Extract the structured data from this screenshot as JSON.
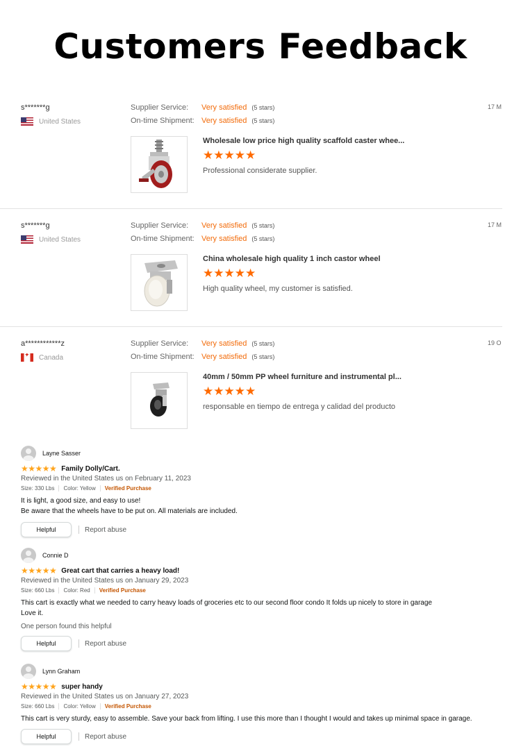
{
  "page": {
    "title": "Customers Feedback"
  },
  "supplier_reviews": [
    {
      "reviewer": "s*******g",
      "country": "United States",
      "flag_icon": "us-flag-icon",
      "date": "17 M",
      "service_label": "Supplier Service:",
      "service_value": "Very satisfied",
      "service_stars": "(5 stars)",
      "shipment_label": "On-time Shipment:",
      "shipment_value": "Very satisfied",
      "shipment_stars": "(5 stars)",
      "product_title": "Wholesale low price high quality scaffold caster whee...",
      "rating": "★★★★★",
      "comment": "Professional considerate supplier."
    },
    {
      "reviewer": "s*******g",
      "country": "United States",
      "flag_icon": "us-flag-icon",
      "date": "17 M",
      "service_label": "Supplier Service:",
      "service_value": "Very satisfied",
      "service_stars": "(5 stars)",
      "shipment_label": "On-time Shipment:",
      "shipment_value": "Very satisfied",
      "shipment_stars": "(5 stars)",
      "product_title": "China wholesale high quality 1 inch castor wheel",
      "rating": "★★★★★",
      "comment": "High quality wheel, my customer is satisfied."
    },
    {
      "reviewer": "a************z",
      "country": "Canada",
      "flag_icon": "canada-flag-icon",
      "date": "19 O",
      "service_label": "Supplier Service:",
      "service_value": "Very satisfied",
      "service_stars": "(5 stars)",
      "shipment_label": "On-time Shipment:",
      "shipment_value": "Very satisfied",
      "shipment_stars": "(5 stars)",
      "product_title": "40mm / 50mm PP wheel furniture and instrumental pl...",
      "rating": "★★★★★",
      "comment": "responsable en tiempo de entrega y calidad del producto"
    }
  ],
  "amazon_reviews": [
    {
      "name": "Layne Sasser",
      "stars": "★★★★★",
      "title": "Family Dolly/Cart.",
      "meta": "Reviewed in the United States us on February 11, 2023",
      "size": "Size: 330 Lbs",
      "color": "Color: Yellow",
      "verified": "Verified Purchase",
      "body_lines": [
        "It is light, a good size, and easy to use!",
        "Be aware that the wheels have to be put on. All materials are included."
      ],
      "helpful_count": "",
      "helpful_label": "Helpful",
      "report_label": "Report abuse"
    },
    {
      "name": "Connie D",
      "stars": "★★★★★",
      "title": "Great cart that carries a heavy load!",
      "meta": "Reviewed in the United States us on January 29, 2023",
      "size": "Size: 660 Lbs",
      "color": "Color: Red",
      "verified": "Verified Purchase",
      "body_lines": [
        "This cart is exactly what we needed to carry heavy loads of groceries etc to our second floor condo It folds up nicely to store in garage",
        "Love it."
      ],
      "helpful_count": "One person found this helpful",
      "helpful_label": "Helpful",
      "report_label": "Report abuse"
    },
    {
      "name": "Lynn Graham",
      "stars": "★★★★★",
      "title": "super handy",
      "meta": "Reviewed in the United States us on January 27, 2023",
      "size": "Size: 660 Lbs",
      "color": "Color: Yellow",
      "verified": "Verified Purchase",
      "body_lines": [
        "This cart is very sturdy, easy to assemble. Save your back from lifting. I use this more than I thought I would and takes up minimal space in garage."
      ],
      "helpful_count": "",
      "helpful_label": "Helpful",
      "report_label": "Report abuse"
    }
  ]
}
